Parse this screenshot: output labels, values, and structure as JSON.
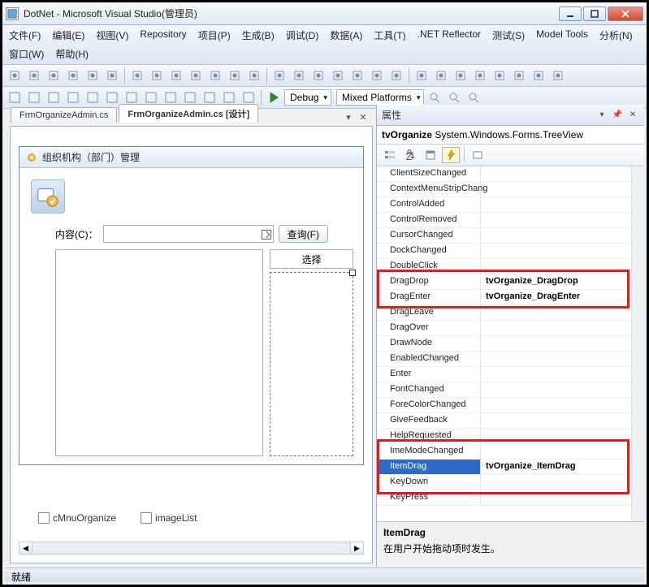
{
  "window": {
    "title": "DotNet - Microsoft Visual Studio(管理员)"
  },
  "menu": {
    "items": [
      "文件(F)",
      "编辑(E)",
      "视图(V)",
      "Repository",
      "项目(P)",
      "生成(B)",
      "调试(D)",
      "数据(A)",
      "工具(T)",
      ".NET Reflector",
      "测试(S)",
      "Model Tools",
      "分析(N)",
      "窗口(W)",
      "帮助(H)"
    ]
  },
  "toolbar2": {
    "config": "Debug",
    "platform": "Mixed Platforms"
  },
  "tabs": {
    "items": [
      {
        "label": "FrmOrganizeAdmin.cs",
        "active": false
      },
      {
        "label": "FrmOrganizeAdmin.cs [设计]",
        "active": true
      }
    ]
  },
  "designer": {
    "form_title": "组织机构（部门）管理",
    "content_label": "内容(C)：",
    "search_btn": "查询(F)",
    "select_header": "选择"
  },
  "tray": {
    "comp1": "cMnuOrganize",
    "comp2": "imageList"
  },
  "properties": {
    "panel_title": "属性",
    "object_name": "tvOrganize",
    "object_type": "System.Windows.Forms.TreeView",
    "rows": [
      {
        "name": "ClientSizeChanged",
        "value": ""
      },
      {
        "name": "ContextMenuStripChang",
        "value": ""
      },
      {
        "name": "ControlAdded",
        "value": ""
      },
      {
        "name": "ControlRemoved",
        "value": ""
      },
      {
        "name": "CursorChanged",
        "value": ""
      },
      {
        "name": "DockChanged",
        "value": ""
      },
      {
        "name": "DoubleClick",
        "value": ""
      },
      {
        "name": "DragDrop",
        "value": "tvOrganize_DragDrop"
      },
      {
        "name": "DragEnter",
        "value": "tvOrganize_DragEnter"
      },
      {
        "name": "DragLeave",
        "value": ""
      },
      {
        "name": "DragOver",
        "value": ""
      },
      {
        "name": "DrawNode",
        "value": ""
      },
      {
        "name": "EnabledChanged",
        "value": ""
      },
      {
        "name": "Enter",
        "value": ""
      },
      {
        "name": "FontChanged",
        "value": ""
      },
      {
        "name": "ForeColorChanged",
        "value": ""
      },
      {
        "name": "GiveFeedback",
        "value": ""
      },
      {
        "name": "HelpRequested",
        "value": ""
      },
      {
        "name": "ImeModeChanged",
        "value": ""
      },
      {
        "name": "ItemDrag",
        "value": "tvOrganize_ItemDrag"
      },
      {
        "name": "KeyDown",
        "value": ""
      },
      {
        "name": "KeyPress",
        "value": ""
      }
    ],
    "selected_row": 19,
    "desc_title": "ItemDrag",
    "desc_text": "在用户开始拖动项时发生。"
  },
  "status": {
    "text": "就绪"
  }
}
